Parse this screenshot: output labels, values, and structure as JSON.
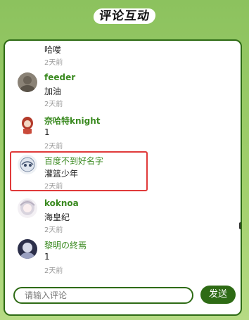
{
  "title": "评论互动",
  "comments": [
    {
      "name": "",
      "text": "哈喽",
      "time": "2天前"
    },
    {
      "name": "feeder",
      "text": "加油",
      "time": "2天前"
    },
    {
      "name": "奈哈特knight",
      "text": "1",
      "time": "2天前"
    },
    {
      "name": "百度不到好名字",
      "text": "灌篮少年",
      "time": "2天前"
    },
    {
      "name": "koknoa",
      "text": "海皇纪",
      "time": "2天前"
    },
    {
      "name": "黎明の終焉",
      "text": "1",
      "time": "2天前"
    }
  ],
  "input": {
    "placeholder": "请输入评论"
  },
  "send_label": "发送",
  "colors": {
    "accent": "#2e6b15",
    "name": "#3a8a20",
    "highlight": "#e03a3a"
  }
}
